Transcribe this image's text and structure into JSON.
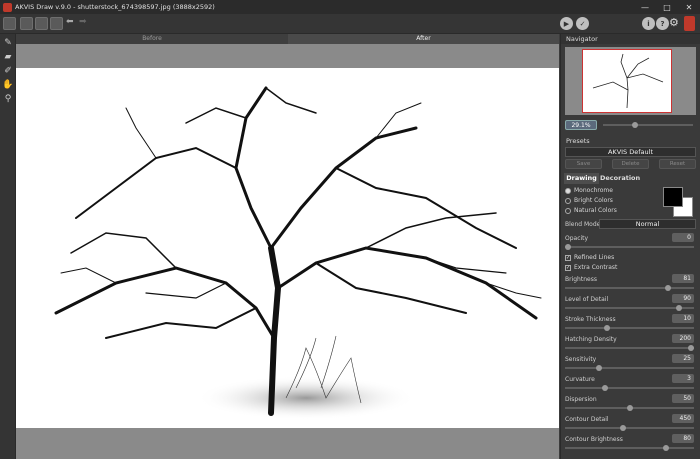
{
  "window": {
    "title": "AKVIS Draw v.9.0 - shutterstock_674398597.jpg (3888x2592)",
    "controls": [
      "—",
      "□",
      "✕"
    ]
  },
  "canvas": {
    "tab_before": "Before",
    "tab_after": "After"
  },
  "toolbar": {
    "info": "i",
    "help": "?"
  },
  "panel": {
    "navigator_title": "Navigator",
    "zoom": "29.1%",
    "presets_title": "Presets",
    "preset_name": "AKVIS Default",
    "save_label": "Save",
    "delete_label": "Delete",
    "reset_label": "Reset",
    "tab_drawing": "Drawing",
    "tab_decoration": "Decoration",
    "modes": [
      "Monochrome",
      "Bright Colors",
      "Natural Colors"
    ],
    "blend_label": "Blend Mode",
    "blend_value": "Normal",
    "refined_lines": "Refined Lines",
    "extra_contrast": "Extra Contrast"
  },
  "params": [
    {
      "label": "Opacity",
      "value": "0",
      "level": 0.0
    },
    {
      "label": "Brightness",
      "value": "81",
      "level": 0.81
    },
    {
      "label": "Level of Detail",
      "value": "90",
      "level": 0.9
    },
    {
      "label": "Stroke Thickness",
      "value": "10",
      "level": 0.32
    },
    {
      "label": "Hatching Density",
      "value": "200",
      "level": 1.0
    },
    {
      "label": "Sensitivity",
      "value": "25",
      "level": 0.25
    },
    {
      "label": "Curvature",
      "value": "3",
      "level": 0.3
    },
    {
      "label": "Dispersion",
      "value": "50",
      "level": 0.5
    },
    {
      "label": "Contour Detail",
      "value": "450",
      "level": 0.45
    },
    {
      "label": "Contour Brightness",
      "value": "80",
      "level": 0.8
    }
  ]
}
